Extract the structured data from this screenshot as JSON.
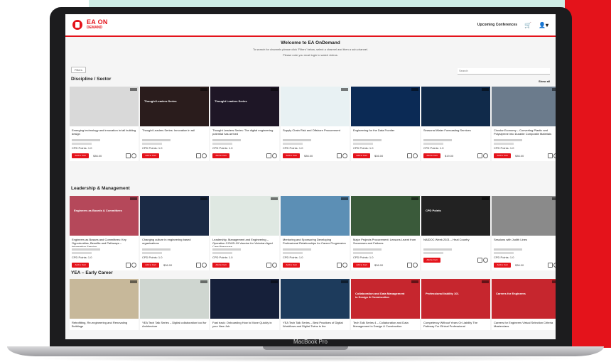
{
  "header": {
    "logo_ea": "EA",
    "logo_on": "ON",
    "logo_demand": "DEMAND",
    "upcoming": "Upcoming Conferences",
    "cart_icon": "cart-icon",
    "user_icon": "user-icon"
  },
  "welcome": {
    "title": "Welcome to EA OnDemand",
    "line1": "To search for channels please click 'Filters' below, select a channel and then a sub-channel.",
    "line2": "Please note you must login to watch videos."
  },
  "controls": {
    "filter_label": "Filters",
    "search_placeholder": "Search",
    "show_all": "Show all"
  },
  "device": {
    "label": "MacBook Pro"
  },
  "common": {
    "add_label": "Add to Cart",
    "cpd_prefix": "CPD Points:"
  },
  "sections": [
    {
      "title": "Discipline / Sector",
      "cards": [
        {
          "title": "Emerging technology and innovation in tall building design",
          "cpd": "1.0",
          "price": "$36.00",
          "bg": "#d9d9d9",
          "thumb_text": ""
        },
        {
          "title": "Thought Leaders Series: Innovation in rail",
          "cpd": "1.0",
          "price": "",
          "bg": "#2a1c1c",
          "thumb_text": "Thought Leaders Series"
        },
        {
          "title": "Thought Leaders Series: The digital engineering potential has arrived",
          "cpd": "1.0",
          "price": "",
          "bg": "#1e1626",
          "thumb_text": "Thought Leaders Series"
        },
        {
          "title": "Supply Chain Risk and Offshore Procurement",
          "cpd": "1.0",
          "price": "$36.00",
          "bg": "#e8f1f3",
          "thumb_text": ""
        },
        {
          "title": "Engineering for the Data Frontier",
          "cpd": "1.0",
          "price": "$36.00",
          "bg": "#0b2a55",
          "thumb_text": ""
        },
        {
          "title": "Seasonal Water Forecasting Services",
          "cpd": "1.0",
          "price": "$19.00",
          "bg": "#102a4a",
          "thumb_text": ""
        },
        {
          "title": "Circular Economy – Converting Plastic and Polystyrene into Durable Composite Materials",
          "cpd": "1.0",
          "price": "$36.00",
          "bg": "#6b7b8c",
          "thumb_text": ""
        }
      ]
    },
    {
      "title": "Leadership & Management",
      "cards": [
        {
          "title": "Engineers as Bosses and Committees: Key Opportunities, Benefits and Pathways – Information Session",
          "cpd": "1.0",
          "price": "",
          "bg": "#b5485a",
          "thumb_text": "Engineers as Boards & Committees"
        },
        {
          "title": "Changing culture in engineering based organisations",
          "cpd": "1.0",
          "price": "$36.00",
          "bg": "#1b2a45",
          "thumb_text": ""
        },
        {
          "title": "Leadership, Management and Engineering – Operation COVID-19 Vaccine for Victorian Aged Care Response",
          "cpd": "1.0",
          "price": "",
          "bg": "#dfe8e2",
          "thumb_text": ""
        },
        {
          "title": "Mentoring and Sponsoring Developing Professional Relationships for Career Progression",
          "cpd": "1.0",
          "price": "",
          "bg": "#5c8fb5",
          "thumb_text": ""
        },
        {
          "title": "Major Projects Procurement: Lessons Learnt from Successes and Failures",
          "cpd": "1.0",
          "price": "$36.00",
          "bg": "#3a5a3a",
          "thumb_text": ""
        },
        {
          "title": "NAIDOC Week 2021 – Heal Country",
          "cpd": "",
          "price": "",
          "bg": "#222222",
          "thumb_text": "CPD Points"
        },
        {
          "title": "Sessions with Judith Lines",
          "cpd": "1.0",
          "price": "$36.00",
          "bg": "#8a8a8a",
          "thumb_text": ""
        }
      ]
    },
    {
      "title": "YEA – Early Career",
      "cards": [
        {
          "title": "Retrofitting, Re-engineering and Renovating Buildings",
          "cpd": "",
          "price": "",
          "bg": "#c7b89a",
          "thumb_text": ""
        },
        {
          "title": "YEA Tech Talk Series – Digital collaboration tool for Architecture",
          "cpd": "",
          "price": "",
          "bg": "#cfd6d0",
          "thumb_text": ""
        },
        {
          "title": "Fast track: Onboarding How to Move Quickly in your New Job",
          "cpd": "",
          "price": "",
          "bg": "#16203a",
          "thumb_text": ""
        },
        {
          "title": "YEA Tech Talk Series – Best Practices of Digital Workflows and Digital Twins in the",
          "cpd": "",
          "price": "",
          "bg": "#1d3b5c",
          "thumb_text": ""
        },
        {
          "title": "Tech Talk Series 4 – Collaboration and Data Management in Design & Construction",
          "cpd": "",
          "price": "",
          "bg": "#c6262e",
          "thumb_text": "Collaboration and Data Management in Design & Construction"
        },
        {
          "title": "Competency Without Years Or Liability The Pathway For Ethical Professional",
          "cpd": "",
          "price": "",
          "bg": "#c6262e",
          "thumb_text": "Professional liability 101"
        },
        {
          "title": "Careers for Engineers Virtual Selection Criteria Masterclass",
          "cpd": "",
          "price": "",
          "bg": "#c6262e",
          "thumb_text": "Careers for Engineers"
        }
      ]
    }
  ]
}
